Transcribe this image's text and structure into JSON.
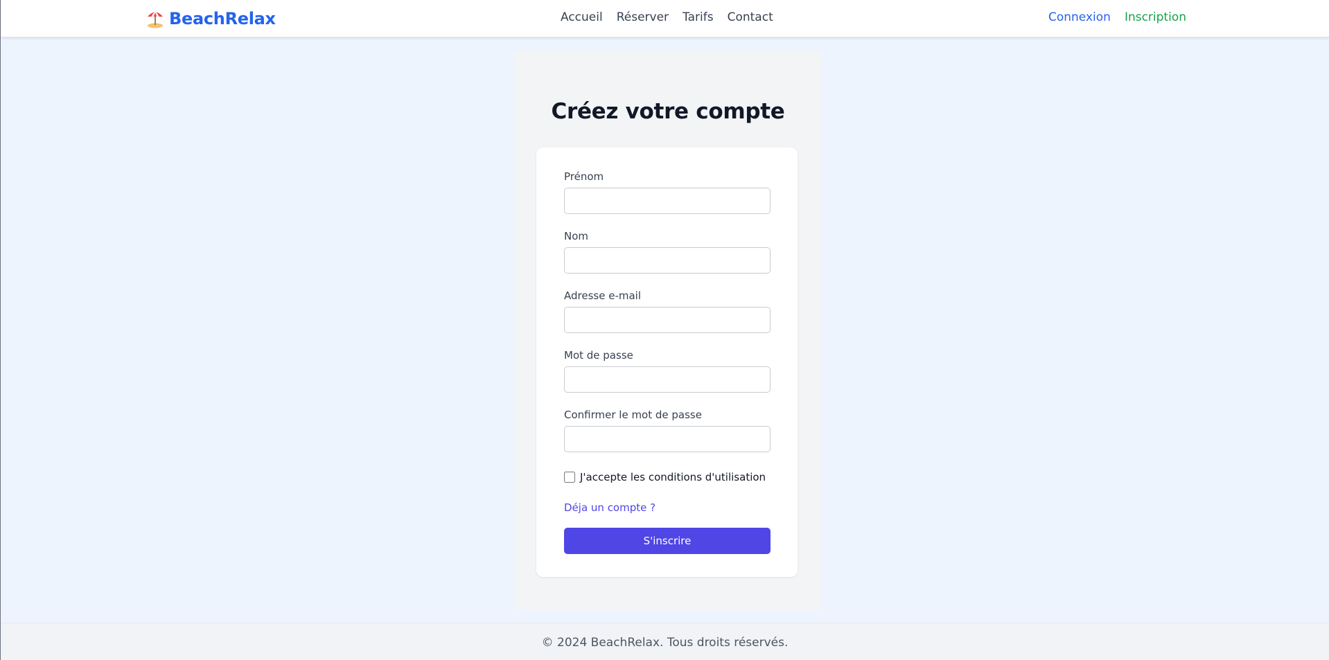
{
  "header": {
    "brand": "BeachRelax",
    "logo_icon": "beach-umbrella-icon",
    "nav": [
      {
        "label": "Accueil"
      },
      {
        "label": "Réserver"
      },
      {
        "label": "Tarifs"
      },
      {
        "label": "Contact"
      }
    ],
    "login_label": "Connexion",
    "signup_label": "Inscription"
  },
  "form": {
    "title": "Créez votre compte",
    "fields": [
      {
        "label": "Prénom",
        "value": ""
      },
      {
        "label": "Nom",
        "value": ""
      },
      {
        "label": "Adresse e-mail",
        "value": ""
      },
      {
        "label": "Mot de passe",
        "value": ""
      },
      {
        "label": "Confirmer le mot de passe",
        "value": ""
      }
    ],
    "terms_label": "J'accepte les conditions d'utilisation",
    "terms_checked": false,
    "have_account_link": "Déja un compte ?",
    "submit_label": "S'inscrire"
  },
  "footer": {
    "text": "© 2024 BeachRelax. Tous droits réservés."
  },
  "colors": {
    "brand": "#2563eb",
    "signup": "#16a34a",
    "primary": "#4f46e5",
    "page_bg": "#eef4fd"
  }
}
